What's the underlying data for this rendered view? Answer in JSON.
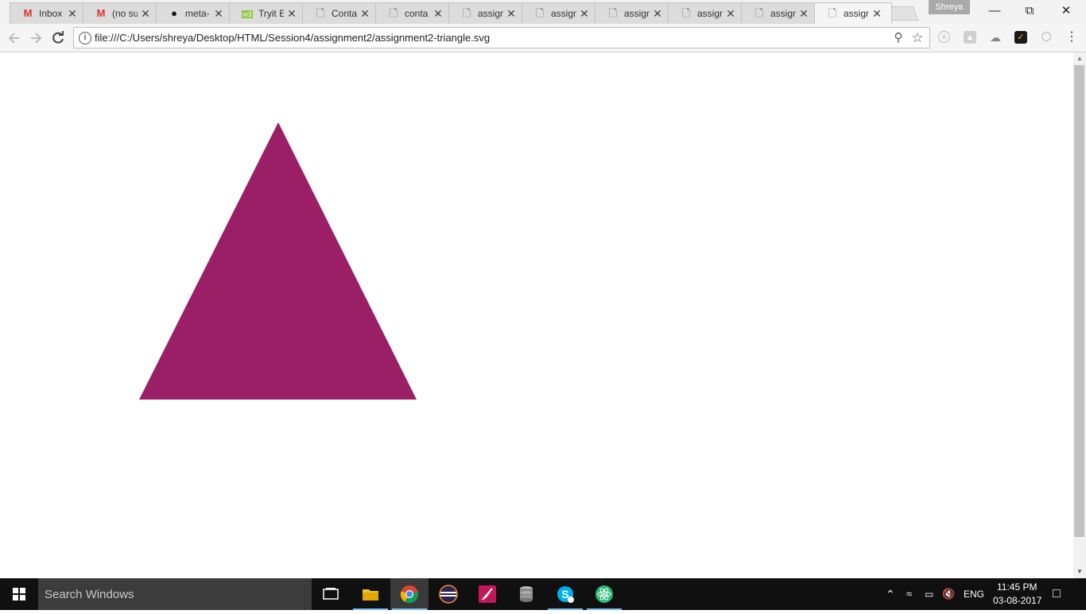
{
  "browser": {
    "tabs": [
      {
        "title": "Inbox",
        "icon": "gmail-icon",
        "active": false
      },
      {
        "title": "(no su",
        "icon": "gmail-icon",
        "active": false
      },
      {
        "title": "meta-",
        "icon": "github-icon",
        "active": false
      },
      {
        "title": "Tryit E",
        "icon": "w3schools-icon",
        "active": false
      },
      {
        "title": "Conta",
        "icon": "page-icon",
        "active": false
      },
      {
        "title": "conta",
        "icon": "page-icon",
        "active": false
      },
      {
        "title": "assign",
        "icon": "page-icon",
        "active": false
      },
      {
        "title": "assign",
        "icon": "page-icon",
        "active": false
      },
      {
        "title": "assign",
        "icon": "page-icon",
        "active": false
      },
      {
        "title": "assign",
        "icon": "page-icon",
        "active": false
      },
      {
        "title": "assign",
        "icon": "page-icon",
        "active": false
      },
      {
        "title": "assign",
        "icon": "page-icon",
        "active": true
      }
    ],
    "profile_name": "Shreya",
    "url": "file:///C:/Users/shreya/Desktop/HTML/Session4/assignment2/assignment2-triangle.svg"
  },
  "page": {
    "shape": "triangle",
    "fill_color": "#9a1f67"
  },
  "taskbar": {
    "search_placeholder": "Search Windows",
    "language": "ENG",
    "time": "11:45 PM",
    "date": "03-08-2017"
  },
  "colors": {
    "taskbar_bg": "#101010",
    "taskbar_accent": "#76b9ed",
    "tab_active": "#f5f5f5",
    "tab_inactive": "#dcdcdc"
  }
}
